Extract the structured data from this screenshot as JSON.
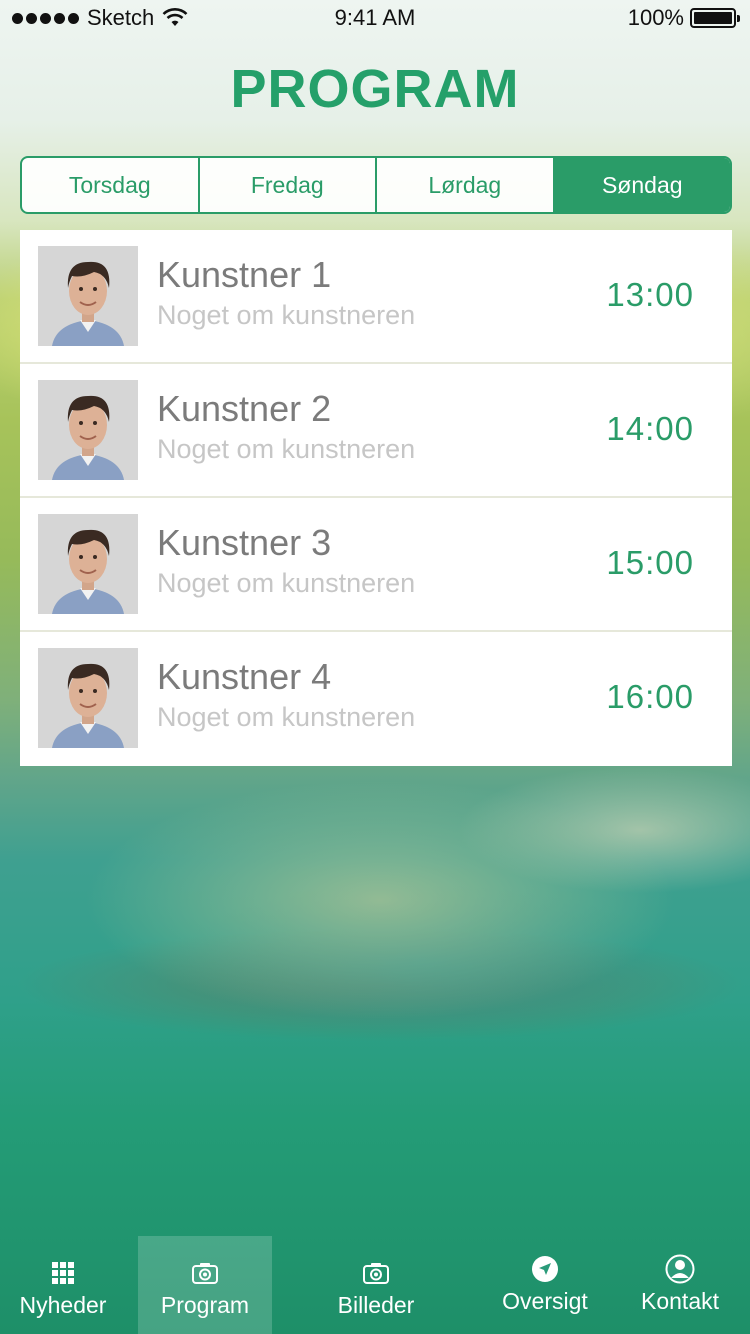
{
  "status_bar": {
    "carrier": "Sketch",
    "time": "9:41 AM",
    "battery": "100%"
  },
  "title": "PROGRAM",
  "day_tabs": [
    {
      "label": "Torsdag",
      "active": false
    },
    {
      "label": "Fredag",
      "active": false
    },
    {
      "label": "Lørdag",
      "active": false
    },
    {
      "label": "Søndag",
      "active": true
    }
  ],
  "artists": [
    {
      "name": "Kunstner 1",
      "description": "Noget om kunstneren",
      "time": "13:00"
    },
    {
      "name": "Kunstner 2",
      "description": "Noget om kunstneren",
      "time": "14:00"
    },
    {
      "name": "Kunstner 3",
      "description": "Noget om kunstneren",
      "time": "15:00"
    },
    {
      "name": "Kunstner 4",
      "description": "Noget om kunstneren",
      "time": "16:00"
    }
  ],
  "tab_bar": [
    {
      "label": "Nyheder",
      "icon": "grid-icon",
      "active": false
    },
    {
      "label": "Program",
      "icon": "camera-icon",
      "active": true
    },
    {
      "label": "Billeder",
      "icon": "camera-icon",
      "active": false
    },
    {
      "label": "Oversigt",
      "icon": "location-arrow-icon",
      "active": false
    },
    {
      "label": "Kontakt",
      "icon": "user-icon",
      "active": false
    }
  ],
  "colors": {
    "accent": "#2a9c68",
    "title": "#25a06a"
  }
}
